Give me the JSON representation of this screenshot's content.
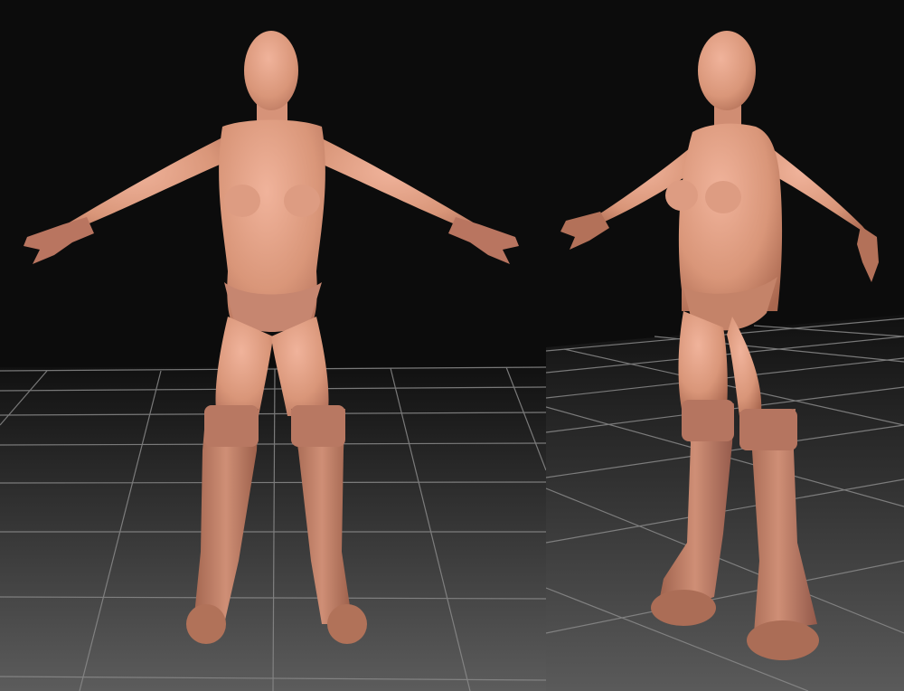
{
  "scene": {
    "background_color": "#0c0c0c",
    "floor_gradient_top": "#101010",
    "floor_gradient_bottom": "#5a5a5a",
    "grid_line_color": "#8c8c8c",
    "clay_skin_light": "#e6a78f",
    "clay_skin_mid": "#d39077",
    "clay_skin_shadow": "#a9674f",
    "boot_light": "#c98a72",
    "boot_shadow": "#8e5745",
    "pose": "A-pose",
    "model_description_icon": "female-base-mesh-figure"
  },
  "viewports": [
    {
      "view": "front"
    },
    {
      "view": "three-quarter"
    }
  ]
}
